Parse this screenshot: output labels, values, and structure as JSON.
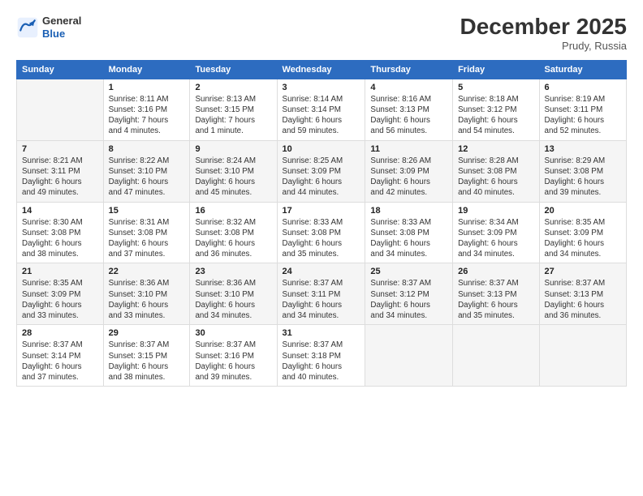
{
  "header": {
    "logo": {
      "general": "General",
      "blue": "Blue"
    },
    "title": "December 2025",
    "location": "Prudy, Russia"
  },
  "weekdays": [
    "Sunday",
    "Monday",
    "Tuesday",
    "Wednesday",
    "Thursday",
    "Friday",
    "Saturday"
  ],
  "weeks": [
    [
      {
        "day": "",
        "info": ""
      },
      {
        "day": "1",
        "info": "Sunrise: 8:11 AM\nSunset: 3:16 PM\nDaylight: 7 hours\nand 4 minutes."
      },
      {
        "day": "2",
        "info": "Sunrise: 8:13 AM\nSunset: 3:15 PM\nDaylight: 7 hours\nand 1 minute."
      },
      {
        "day": "3",
        "info": "Sunrise: 8:14 AM\nSunset: 3:14 PM\nDaylight: 6 hours\nand 59 minutes."
      },
      {
        "day": "4",
        "info": "Sunrise: 8:16 AM\nSunset: 3:13 PM\nDaylight: 6 hours\nand 56 minutes."
      },
      {
        "day": "5",
        "info": "Sunrise: 8:18 AM\nSunset: 3:12 PM\nDaylight: 6 hours\nand 54 minutes."
      },
      {
        "day": "6",
        "info": "Sunrise: 8:19 AM\nSunset: 3:11 PM\nDaylight: 6 hours\nand 52 minutes."
      }
    ],
    [
      {
        "day": "7",
        "info": "Sunrise: 8:21 AM\nSunset: 3:11 PM\nDaylight: 6 hours\nand 49 minutes."
      },
      {
        "day": "8",
        "info": "Sunrise: 8:22 AM\nSunset: 3:10 PM\nDaylight: 6 hours\nand 47 minutes."
      },
      {
        "day": "9",
        "info": "Sunrise: 8:24 AM\nSunset: 3:10 PM\nDaylight: 6 hours\nand 45 minutes."
      },
      {
        "day": "10",
        "info": "Sunrise: 8:25 AM\nSunset: 3:09 PM\nDaylight: 6 hours\nand 44 minutes."
      },
      {
        "day": "11",
        "info": "Sunrise: 8:26 AM\nSunset: 3:09 PM\nDaylight: 6 hours\nand 42 minutes."
      },
      {
        "day": "12",
        "info": "Sunrise: 8:28 AM\nSunset: 3:08 PM\nDaylight: 6 hours\nand 40 minutes."
      },
      {
        "day": "13",
        "info": "Sunrise: 8:29 AM\nSunset: 3:08 PM\nDaylight: 6 hours\nand 39 minutes."
      }
    ],
    [
      {
        "day": "14",
        "info": "Sunrise: 8:30 AM\nSunset: 3:08 PM\nDaylight: 6 hours\nand 38 minutes."
      },
      {
        "day": "15",
        "info": "Sunrise: 8:31 AM\nSunset: 3:08 PM\nDaylight: 6 hours\nand 37 minutes."
      },
      {
        "day": "16",
        "info": "Sunrise: 8:32 AM\nSunset: 3:08 PM\nDaylight: 6 hours\nand 36 minutes."
      },
      {
        "day": "17",
        "info": "Sunrise: 8:33 AM\nSunset: 3:08 PM\nDaylight: 6 hours\nand 35 minutes."
      },
      {
        "day": "18",
        "info": "Sunrise: 8:33 AM\nSunset: 3:08 PM\nDaylight: 6 hours\nand 34 minutes."
      },
      {
        "day": "19",
        "info": "Sunrise: 8:34 AM\nSunset: 3:09 PM\nDaylight: 6 hours\nand 34 minutes."
      },
      {
        "day": "20",
        "info": "Sunrise: 8:35 AM\nSunset: 3:09 PM\nDaylight: 6 hours\nand 34 minutes."
      }
    ],
    [
      {
        "day": "21",
        "info": "Sunrise: 8:35 AM\nSunset: 3:09 PM\nDaylight: 6 hours\nand 33 minutes."
      },
      {
        "day": "22",
        "info": "Sunrise: 8:36 AM\nSunset: 3:10 PM\nDaylight: 6 hours\nand 33 minutes."
      },
      {
        "day": "23",
        "info": "Sunrise: 8:36 AM\nSunset: 3:10 PM\nDaylight: 6 hours\nand 34 minutes."
      },
      {
        "day": "24",
        "info": "Sunrise: 8:37 AM\nSunset: 3:11 PM\nDaylight: 6 hours\nand 34 minutes."
      },
      {
        "day": "25",
        "info": "Sunrise: 8:37 AM\nSunset: 3:12 PM\nDaylight: 6 hours\nand 34 minutes."
      },
      {
        "day": "26",
        "info": "Sunrise: 8:37 AM\nSunset: 3:13 PM\nDaylight: 6 hours\nand 35 minutes."
      },
      {
        "day": "27",
        "info": "Sunrise: 8:37 AM\nSunset: 3:13 PM\nDaylight: 6 hours\nand 36 minutes."
      }
    ],
    [
      {
        "day": "28",
        "info": "Sunrise: 8:37 AM\nSunset: 3:14 PM\nDaylight: 6 hours\nand 37 minutes."
      },
      {
        "day": "29",
        "info": "Sunrise: 8:37 AM\nSunset: 3:15 PM\nDaylight: 6 hours\nand 38 minutes."
      },
      {
        "day": "30",
        "info": "Sunrise: 8:37 AM\nSunset: 3:16 PM\nDaylight: 6 hours\nand 39 minutes."
      },
      {
        "day": "31",
        "info": "Sunrise: 8:37 AM\nSunset: 3:18 PM\nDaylight: 6 hours\nand 40 minutes."
      },
      {
        "day": "",
        "info": ""
      },
      {
        "day": "",
        "info": ""
      },
      {
        "day": "",
        "info": ""
      }
    ]
  ]
}
